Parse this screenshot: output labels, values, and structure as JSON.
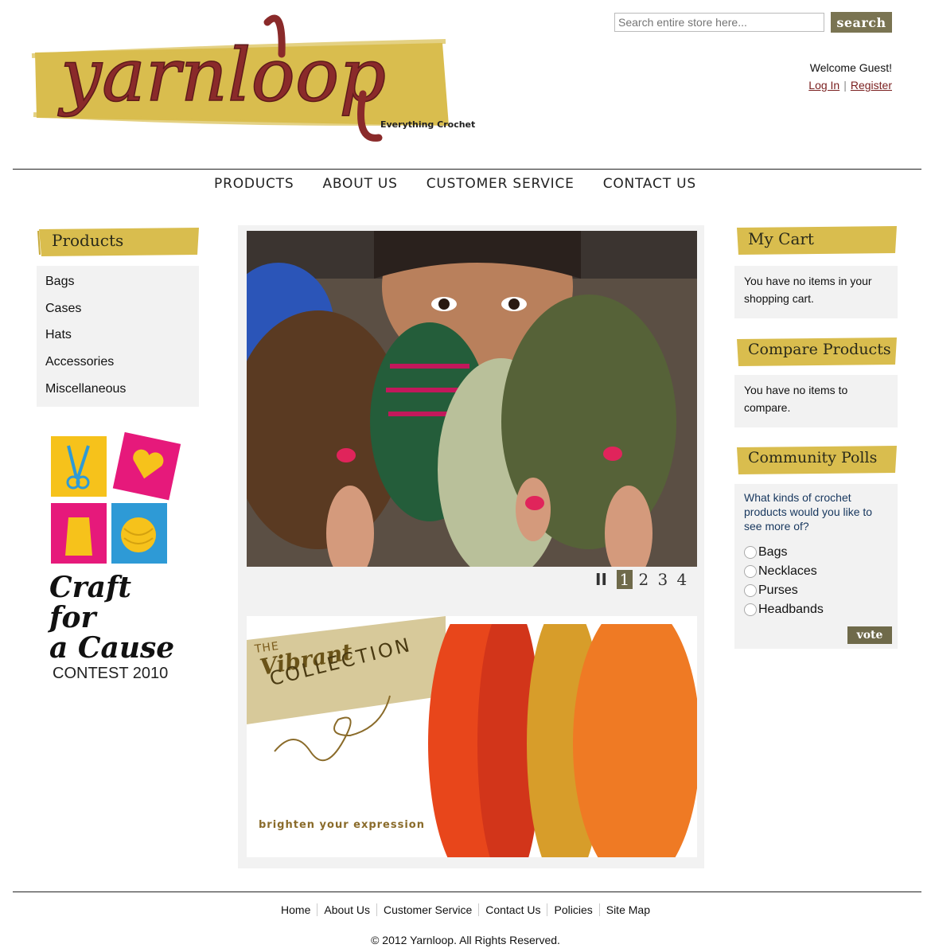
{
  "header": {
    "logo_text": "yarnloop",
    "logo_tagline": "Everything Crochet",
    "search_placeholder": "Search entire store here...",
    "search_button": "search",
    "welcome": "Welcome Guest!",
    "login": "Log In",
    "separator": "|",
    "register": "Register"
  },
  "topnav": [
    "PRODUCTS",
    "ABOUT US",
    "CUSTOMER SERVICE",
    "CONTACT US"
  ],
  "left_sidebar": {
    "title": "Products",
    "items": [
      "Bags",
      "Cases",
      "Hats",
      "Accessories",
      "Miscellaneous"
    ],
    "promo": {
      "line1": "Craft for",
      "line2": "a Cause",
      "line3": "CONTEST 2010"
    }
  },
  "slideshow": {
    "pause": "II",
    "pages": [
      "1",
      "2",
      "3",
      "4"
    ],
    "active_page": "1"
  },
  "banner": {
    "the": "THE",
    "vibrant": "Vibrant",
    "collection": "COLLECTION",
    "tagline": "brighten your expression"
  },
  "right_sidebar": {
    "cart_title": "My Cart",
    "cart_text": "You have no items in your shopping cart.",
    "compare_title": "Compare Products",
    "compare_text": "You have no items to compare.",
    "polls_title": "Community Polls",
    "poll_question": "What kinds of crochet products would you like to see more of?",
    "poll_options": [
      "Bags",
      "Necklaces",
      "Purses",
      "Headbands"
    ],
    "vote_button": "vote"
  },
  "footer": {
    "links": [
      "Home",
      "About Us",
      "Customer Service",
      "Contact Us",
      "Policies",
      "Site Map"
    ],
    "copyright": "© 2012 Yarnloop. All Rights Reserved."
  },
  "colors": {
    "brand_yellow": "#d9bd4e",
    "brand_dark": "#6f6a4a",
    "yarn_red": "#8a2a2a",
    "panel_gray": "#f2f2f2",
    "link_red": "#7a1f1f"
  }
}
